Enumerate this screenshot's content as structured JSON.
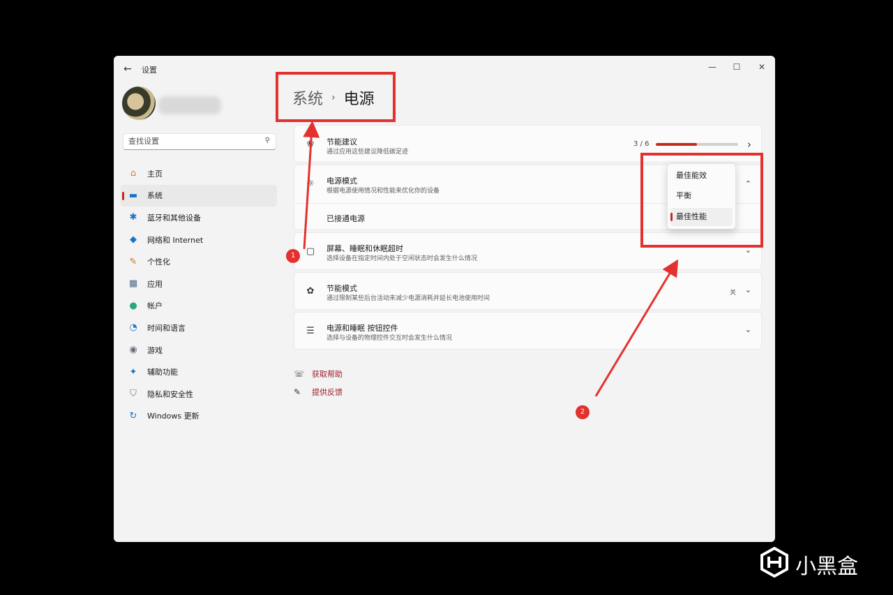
{
  "window": {
    "title": "设置",
    "back_glyph": "←",
    "controls": {
      "minimize": "—",
      "maximize": "☐",
      "close": "✕"
    }
  },
  "search": {
    "placeholder": "查找设置"
  },
  "sidebar": {
    "items": [
      {
        "label": "主页",
        "icon": "home-icon",
        "glyph": "⌂",
        "color": "#d97b35"
      },
      {
        "label": "系统",
        "icon": "monitor-icon",
        "glyph": "▬",
        "color": "#1a73c8",
        "active": true
      },
      {
        "label": "蓝牙和其他设备",
        "icon": "bluetooth-icon",
        "glyph": "✱",
        "color": "#1a73c8"
      },
      {
        "label": "网络和 Internet",
        "icon": "wifi-icon",
        "glyph": "◆",
        "color": "#1a73c8"
      },
      {
        "label": "个性化",
        "icon": "brush-icon",
        "glyph": "✎",
        "color": "#c47a2c"
      },
      {
        "label": "应用",
        "icon": "apps-icon",
        "glyph": "▦",
        "color": "#4a6a8a"
      },
      {
        "label": "帐户",
        "icon": "account-icon",
        "glyph": "●",
        "color": "#2aa87a"
      },
      {
        "label": "时间和语言",
        "icon": "globe-clock-icon",
        "glyph": "◔",
        "color": "#1a73c8"
      },
      {
        "label": "游戏",
        "icon": "gamepad-icon",
        "glyph": "◉",
        "color": "#6a6a7a"
      },
      {
        "label": "辅助功能",
        "icon": "accessibility-icon",
        "glyph": "✦",
        "color": "#1a73c8"
      },
      {
        "label": "隐私和安全性",
        "icon": "shield-icon",
        "glyph": "⛉",
        "color": "#6a7a8a"
      },
      {
        "label": "Windows 更新",
        "icon": "update-icon",
        "glyph": "↻",
        "color": "#1a73c8"
      }
    ]
  },
  "header": {
    "parent": "系统",
    "separator": "›",
    "current": "电源"
  },
  "cards": {
    "energy": {
      "title": "节能建议",
      "desc": "通过应用这些建议降低碳足迹",
      "progress_text": "3 / 6",
      "progress": 0.5,
      "chevron": "›"
    },
    "power_mode": {
      "title": "电源模式",
      "desc": "根据电源使用情况和性能来优化你的设备",
      "sub_label": "已接通电源",
      "chevron": "⌃"
    },
    "screen_sleep": {
      "title": "屏幕、睡眠和休眠超时",
      "desc": "选择设备在指定时间内处于空闲状态时会发生什么情况",
      "chevron": "⌄"
    },
    "saver": {
      "title": "节能模式",
      "desc": "通过限制某些后台活动来减少电源消耗并延长电池使用时间",
      "state": "关",
      "chevron": "⌄"
    },
    "buttons": {
      "title": "电源和睡眠 按钮控件",
      "desc": "选择与设备的物理控件交互时会发生什么情况",
      "chevron": "⌄"
    }
  },
  "power_mode_dropdown": {
    "options": [
      "最佳能效",
      "平衡",
      "最佳性能"
    ],
    "selected": "最佳性能"
  },
  "links": {
    "help": "获取帮助",
    "feedback": "提供反馈"
  },
  "annotations": {
    "badge1": "1",
    "badge2": "2",
    "color": "#e3312f"
  },
  "watermark": {
    "text": "小黑盒"
  },
  "colors": {
    "accent": "#c42b1c",
    "window_bg": "#f3f3f3",
    "card_bg": "#fbfbfb",
    "link": "#9a1f2a"
  }
}
